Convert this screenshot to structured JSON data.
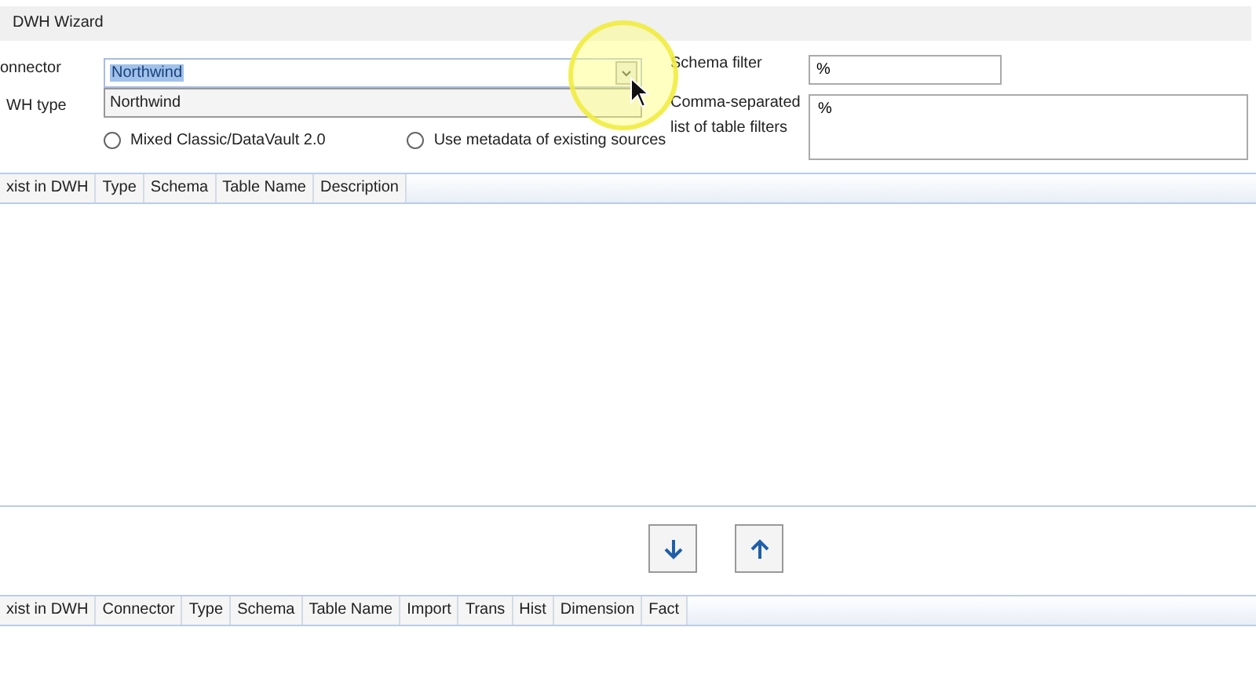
{
  "window": {
    "title": "DWH Wizard"
  },
  "connector": {
    "label": "onnector",
    "value": "Northwind",
    "dropdown_items": [
      "Northwind"
    ]
  },
  "dwh_type": {
    "label": "WH type",
    "options": [
      {
        "label": "Mixed Classic/DataVault 2.0",
        "selected": false
      },
      {
        "label": "Use metadata of existing sources",
        "selected": false
      }
    ]
  },
  "schema_filter": {
    "label": "Schema filter",
    "value": "%"
  },
  "table_filters": {
    "label": "Comma-separated list of table filters",
    "value": "%"
  },
  "source_table": {
    "columns": [
      "xist in DWH",
      "Type",
      "Schema",
      "Table Name",
      "Description"
    ]
  },
  "move_buttons": [
    {
      "kind": "down"
    },
    {
      "kind": "up"
    }
  ],
  "target_table": {
    "columns": [
      "xist in DWH",
      "Connector",
      "Type",
      "Schema",
      "Table Name",
      "Import",
      "Trans",
      "Hist",
      "Dimension",
      "Fact"
    ]
  }
}
